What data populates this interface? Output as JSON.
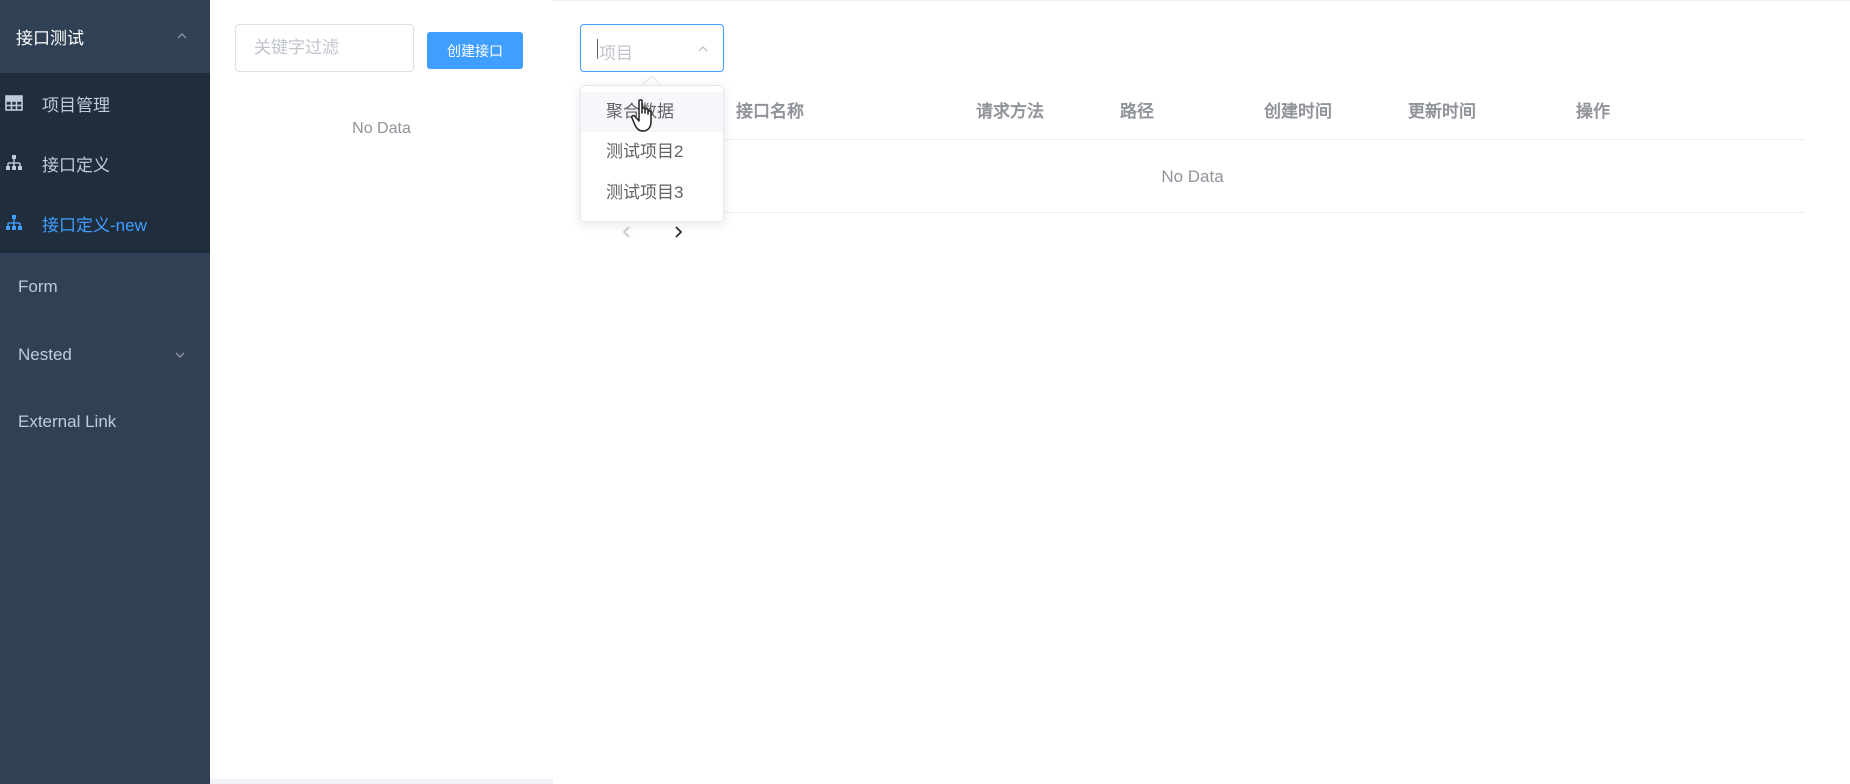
{
  "sidebar": {
    "submenu_title": "接口测试",
    "items": [
      {
        "label": "项目管理",
        "icon": "table-icon"
      },
      {
        "label": "接口定义",
        "icon": "sitemap-icon"
      },
      {
        "label": "接口定义-new",
        "icon": "sitemap-icon",
        "active": true
      }
    ],
    "top_items": [
      {
        "label": "Form"
      },
      {
        "label": "Nested",
        "has_children": true
      },
      {
        "label": "External Link"
      }
    ]
  },
  "interface_list": {
    "filter_placeholder": "关键字过滤",
    "create_button_label": "创建接口",
    "empty_text": "No Data"
  },
  "main": {
    "project_select": {
      "placeholder": "项目",
      "open": true,
      "options": [
        "聚合数据",
        "测试项目2",
        "测试项目3"
      ],
      "hovered_index": 0
    },
    "table": {
      "columns": [
        "接口名称",
        "请求方法",
        "路径",
        "创建时间",
        "更新时间",
        "操作"
      ],
      "rows": [],
      "empty_text": "No Data"
    }
  },
  "colors": {
    "sidebar_bg": "#304156",
    "submenu_bg": "#1f2d3d",
    "sidebar_text": "#bfcbd9",
    "accent": "#409eff",
    "muted_text": "#909399"
  }
}
